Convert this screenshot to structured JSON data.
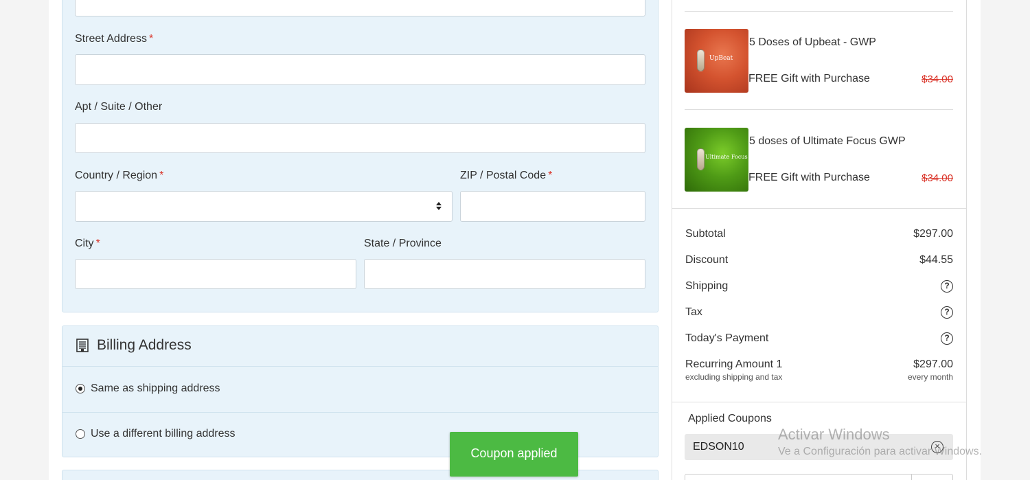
{
  "shipping_form": {
    "street_label": "Street Address",
    "apt_label": "Apt / Suite / Other",
    "country_label": "Country / Region",
    "zip_label": "ZIP / Postal Code",
    "city_label": "City",
    "state_label": "State / Province",
    "required_mark": "*",
    "street_value": "",
    "apt_value": "",
    "country_value": "",
    "zip_value": "",
    "city_value": "",
    "state_value": ""
  },
  "billing": {
    "title": "Billing Address",
    "options": [
      {
        "label": "Same as shipping address",
        "selected": true
      },
      {
        "label": "Use a different billing address",
        "selected": false
      }
    ]
  },
  "order_items": [
    {
      "name": "5 Doses of Upbeat - GWP",
      "subtitle": "FREE Gift with Purchase",
      "price": "$34.00",
      "thumb_brand": "UpBeat"
    },
    {
      "name": "5 doses of Ultimate Focus GWP",
      "subtitle": "FREE Gift with Purchase",
      "price": "$34.00",
      "thumb_brand": "Ultimate Focus"
    }
  ],
  "summary": {
    "subtotal_label": "Subtotal",
    "subtotal_value": "$297.00",
    "discount_label": "Discount",
    "discount_value": "$44.55",
    "shipping_label": "Shipping",
    "tax_label": "Tax",
    "todays_payment_label": "Today's Payment",
    "recurring_label": "Recurring Amount 1",
    "recurring_note": "excluding shipping and tax",
    "recurring_value": "$297.00",
    "recurring_period": "every month",
    "info_glyph": "?"
  },
  "coupons": {
    "title": "Applied Coupons",
    "code": "EDSON10",
    "remove_glyph": "×"
  },
  "toast": {
    "message": "Coupon applied"
  },
  "watermark": {
    "title": "Activar Windows",
    "subtitle": "Ve a Configuración para activar Windows."
  },
  "colors": {
    "panel_bg": "#e8f3fa",
    "required": "#d93025",
    "toast_bg": "#4cba43",
    "strike_price": "#d93025"
  }
}
